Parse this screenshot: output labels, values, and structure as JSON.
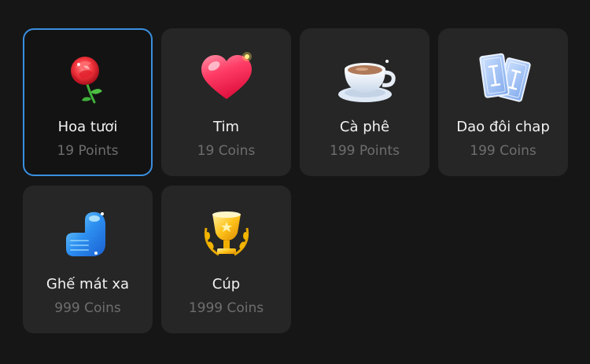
{
  "gifts": [
    {
      "name": "Hoa tươi",
      "price": "19 Points",
      "icon": "rose-icon",
      "selected": true
    },
    {
      "name": "Tim",
      "price": "19 Coins",
      "icon": "heart-icon",
      "selected": false
    },
    {
      "name": "Cà phê",
      "price": "199 Points",
      "icon": "coffee-cup-icon",
      "selected": false
    },
    {
      "name": "Dao đôi chap",
      "price": "199 Coins",
      "icon": "tarot-cards-icon",
      "selected": false
    },
    {
      "name": "Ghế mát xa",
      "price": "999 Coins",
      "icon": "massage-chair-icon",
      "selected": false
    },
    {
      "name": "Cúp",
      "price": "1999 Coins",
      "icon": "trophy-icon",
      "selected": false
    }
  ],
  "colors": {
    "background": "#161616",
    "card": "#262626",
    "selected_border": "#3a8fe0",
    "name_text": "#f2f2f2",
    "price_text": "#6e6e6e"
  }
}
